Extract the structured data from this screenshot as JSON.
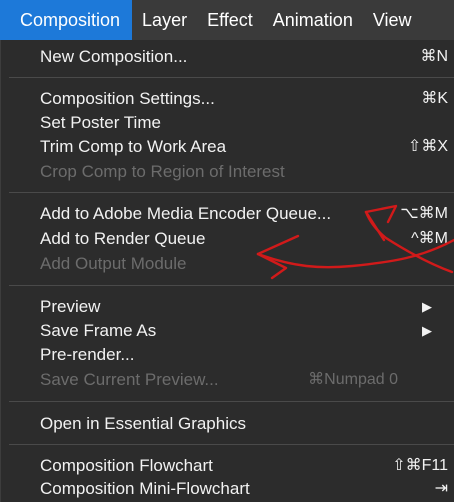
{
  "menubar": {
    "items": [
      {
        "label": "Composition",
        "active": true
      },
      {
        "label": "Layer"
      },
      {
        "label": "Effect"
      },
      {
        "label": "Animation"
      },
      {
        "label": "View"
      }
    ]
  },
  "menu": {
    "groups": [
      [
        {
          "label": "New Composition...",
          "shortcut": "⌘N"
        }
      ],
      [
        {
          "label": "Composition Settings...",
          "shortcut": "⌘K"
        },
        {
          "label": "Set Poster Time"
        },
        {
          "label": "Trim Comp to Work Area",
          "shortcut": "⇧⌘X"
        },
        {
          "label": "Crop Comp to Region of Interest",
          "disabled": true
        }
      ],
      [
        {
          "label": "Add to Adobe Media Encoder Queue...",
          "shortcut": "⌥⌘M"
        },
        {
          "label": "Add to Render Queue",
          "shortcut": "^⌘M"
        },
        {
          "label": "Add Output Module",
          "disabled": true
        }
      ],
      [
        {
          "label": "Preview",
          "submenu": "▶"
        },
        {
          "label": "Save Frame As",
          "submenu": "▶"
        },
        {
          "label": "Pre-render..."
        },
        {
          "label": "Save Current Preview...",
          "shortcut": "⌘Numpad 0",
          "disabled": true
        }
      ],
      [
        {
          "label": "Open in Essential Graphics"
        }
      ],
      [
        {
          "label": "Composition Flowchart",
          "shortcut": "⇧⌘F11"
        },
        {
          "label": "Composition Mini-Flowchart",
          "shortcut": "⇥"
        }
      ]
    ]
  },
  "colors": {
    "menubar_bg": "#3a3a3a",
    "active_bg": "#1d79d9",
    "menu_bg": "#2c2c2c",
    "text": "#f2f2f2",
    "disabled_text": "#6c6c6c",
    "annotation": "#d11a1a"
  }
}
